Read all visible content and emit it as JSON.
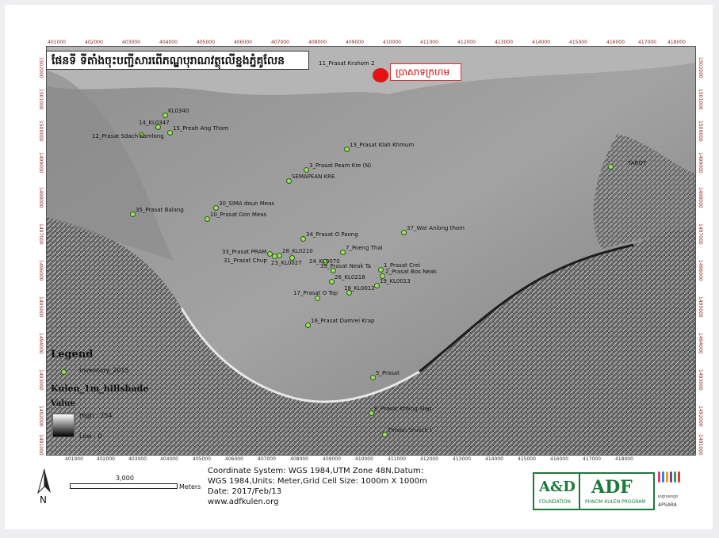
{
  "map_title": "ផែនទី ទីតាំងចុះបញ្ជីសារពើភណ្ឌបុរាណវត្ថុលើខ្នងភ្នំគូលែន",
  "callout": {
    "label": "ប្រាសាទក្រហម"
  },
  "top_ticks": [
    "401000",
    "402000",
    "403000",
    "404000",
    "405000",
    "406000",
    "407000",
    "408000",
    "409000",
    "410000",
    "411000",
    "412000",
    "413000",
    "414000",
    "415000",
    "416000",
    "417000",
    "418000"
  ],
  "bottom_ticks": [
    "401000",
    "402000",
    "403000",
    "404000",
    "405000",
    "406000",
    "407000",
    "408000",
    "409000",
    "410000",
    "411000",
    "412000",
    "413000",
    "414000",
    "415000",
    "416000",
    "417000",
    "418000"
  ],
  "left_ticks": [
    "1502000",
    "1501000",
    "1500000",
    "1499000",
    "1498000",
    "1497000",
    "1496000",
    "1495000",
    "1494000",
    "1493000",
    "1492000",
    "1491000"
  ],
  "right_ticks": [
    "1502000",
    "1501000",
    "1500000",
    "1499000",
    "1498000",
    "1497000",
    "1496000",
    "1495000",
    "1494000",
    "1493000",
    "1492000",
    "1491000"
  ],
  "sites": [
    {
      "label": "11_Prasat Krahom 2"
    },
    {
      "label": "KL0340"
    },
    {
      "label": "14_KL0347"
    },
    {
      "label": "12_Prasat Sdach Komlong"
    },
    {
      "label": "15_Preah Ang Thom"
    },
    {
      "label": "13_Prasat Klah Khmum"
    },
    {
      "label": "3_Prasat Peam Kre (N)"
    },
    {
      "label": "SEMAPEAN KRE"
    },
    {
      "label": "TAROT"
    },
    {
      "label": "35_Prasat Balang"
    },
    {
      "label": "30_SIMA doun Meas"
    },
    {
      "label": "10_Prasat Don Meas"
    },
    {
      "label": "37_Wat Anlong thom"
    },
    {
      "label": "34_Prasat O Paong"
    },
    {
      "label": "33_Prasat PRAM"
    },
    {
      "label": "28_KL0210"
    },
    {
      "label": "31_Prasat Chup"
    },
    {
      "label": "23_KL0027"
    },
    {
      "label": "7_Poeng Thal"
    },
    {
      "label": "24_KL0070"
    },
    {
      "label": "1_Prasat Crei"
    },
    {
      "label": "39_Prasat Neak Ta"
    },
    {
      "label": "2_Prasat Bos Neak"
    },
    {
      "label": "26_KL0218"
    },
    {
      "label": "19_KL0013"
    },
    {
      "label": "17_Prasat O Top"
    },
    {
      "label": "18_KL0012"
    },
    {
      "label": "16_Prasat Damrei Krap"
    },
    {
      "label": "5_Prasat"
    },
    {
      "label": "8_Prasat Khting Slap"
    },
    {
      "label": "Thmon Sruoch I"
    }
  ],
  "legend": {
    "heading": "Legend",
    "inventory_label": "Inventory_2015",
    "layer_label": "Kulen_1m_hillshade",
    "value_label": "Value",
    "high_label": "High : 254",
    "low_label": "Low : 0"
  },
  "north_arrow": "N",
  "scale_bar": {
    "value": "3,000",
    "unit": "Meters"
  },
  "info": {
    "line1": "Coordinate System: WGS 1984,UTM Zone 48N,Datum:",
    "line2": "WGS 1984,Units: Meter,Grid Cell Size: 1000m X 1000m",
    "line3": "Date: 2017/Feb/13",
    "line4": "www.adfkulen.org"
  },
  "logos": {
    "adf_foundation_big": "A&D",
    "adf_foundation_small": "FOUNDATION",
    "adf_big": "ADF",
    "adf_small": "PHNOM KULEN PROGRAM",
    "apsara_kh": "អាជ្ញាធរអប្សរា",
    "apsara": "APSARA"
  },
  "colors": {
    "site_marker": "#9fe060",
    "highlight_marker": "#e41414",
    "tick_label": "#8a1f1f",
    "logo_green": "#1a7a3a"
  }
}
